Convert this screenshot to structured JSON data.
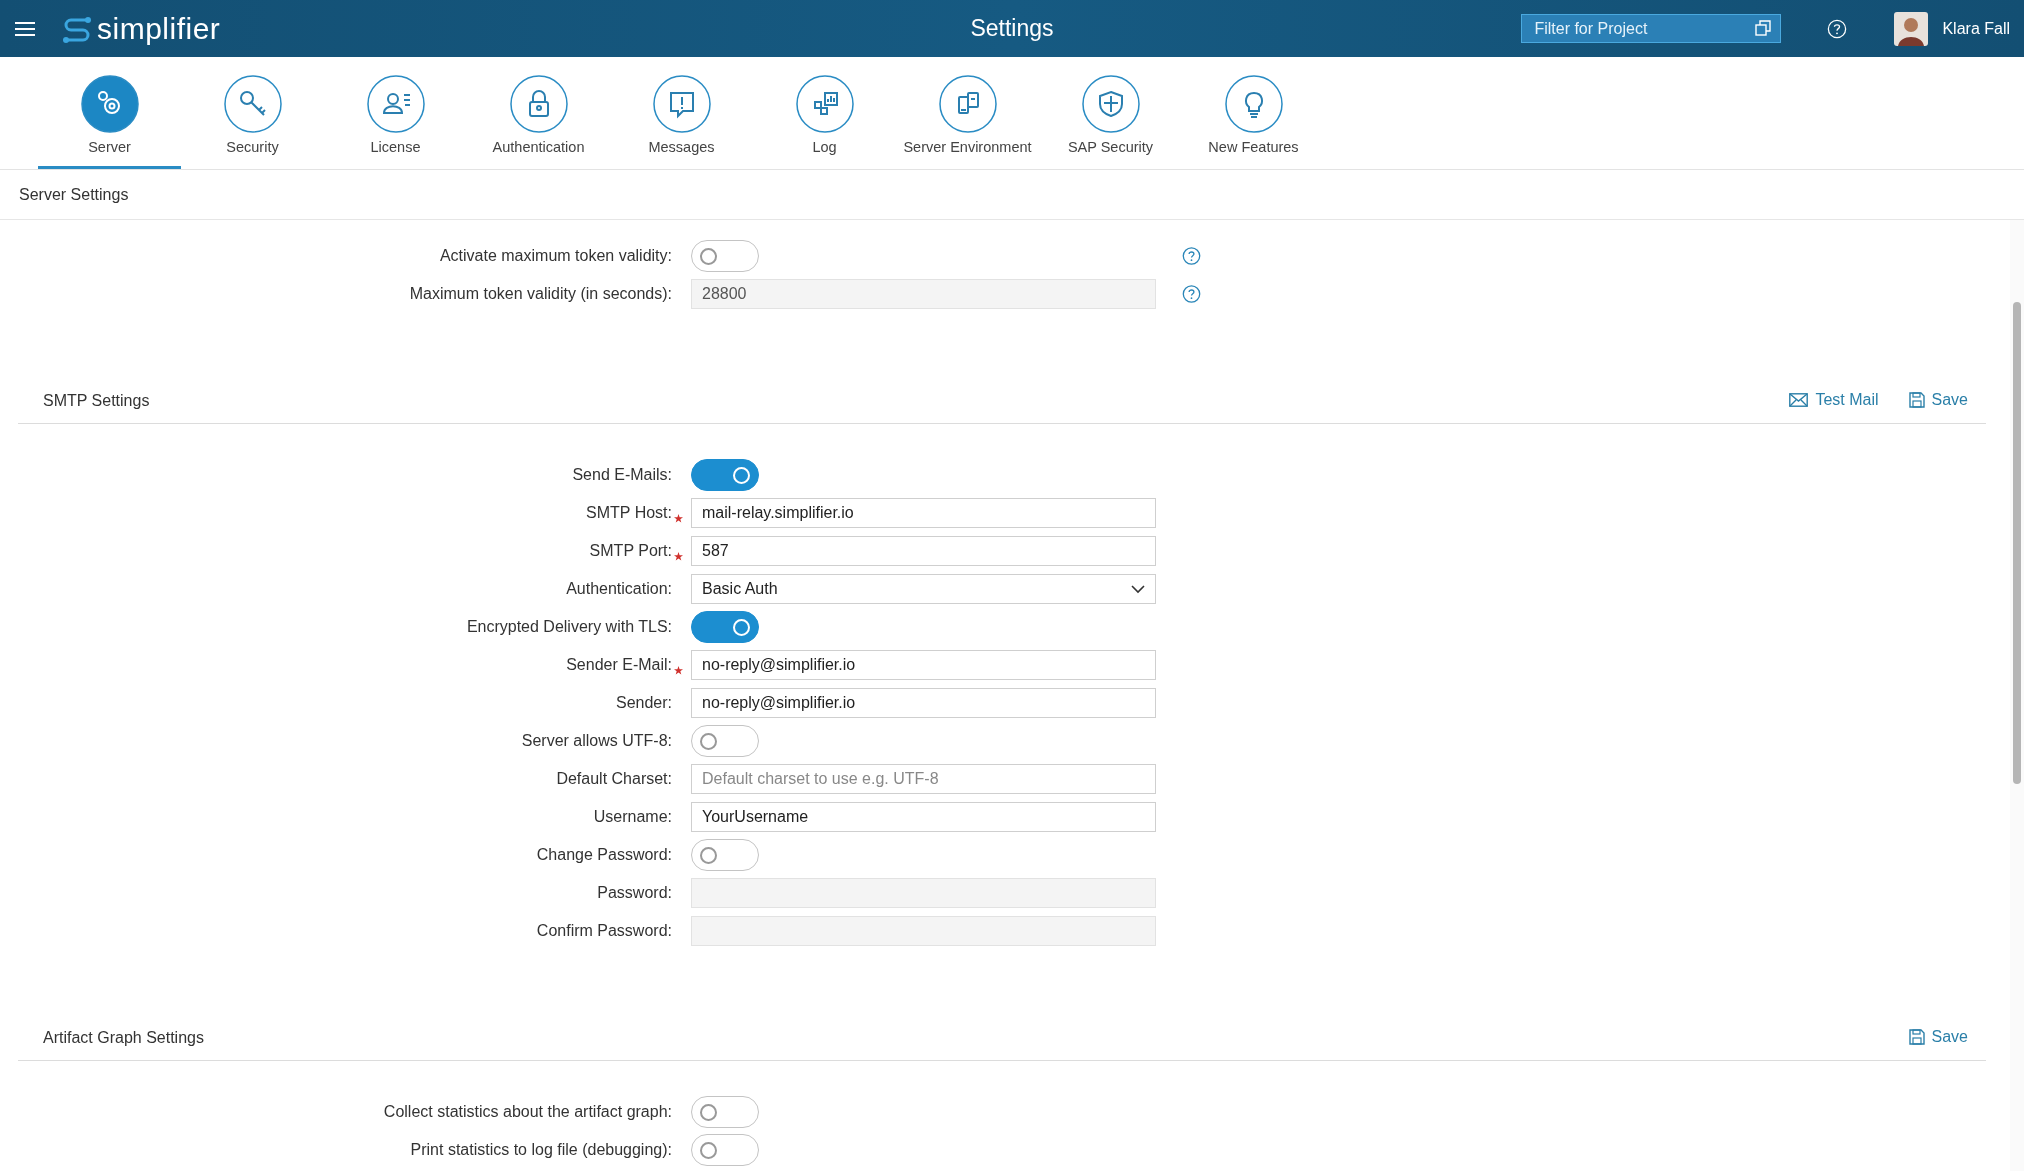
{
  "header": {
    "logo": "simplifier",
    "title": "Settings",
    "filter": {
      "placeholder": "Filter for Project"
    },
    "user": "Klara Fall"
  },
  "tabs": [
    {
      "label": "Server",
      "selected": true
    },
    {
      "label": "Security",
      "selected": false
    },
    {
      "label": "License",
      "selected": false
    },
    {
      "label": "Authentication",
      "selected": false
    },
    {
      "label": "Messages",
      "selected": false
    },
    {
      "label": "Log",
      "selected": false
    },
    {
      "label": "Server Environment",
      "selected": false
    },
    {
      "label": "SAP Security",
      "selected": false
    },
    {
      "label": "New Features",
      "selected": false
    }
  ],
  "page_title": "Server Settings",
  "server_rows": [
    {
      "label": "Activate maximum token validity:",
      "kind": "toggle",
      "on": false,
      "required": false,
      "help": true
    },
    {
      "label": "Maximum token validity (in seconds):",
      "kind": "input",
      "value": "28800",
      "disabled": true,
      "required": false,
      "help": true
    }
  ],
  "sections": [
    {
      "title": "SMTP Settings",
      "actions": [
        {
          "kind": "mail",
          "label": "Test Mail"
        },
        {
          "kind": "save",
          "label": "Save"
        }
      ],
      "rows": [
        {
          "label": "Send E-Mails:",
          "kind": "toggle",
          "on": true,
          "required": false,
          "help": false
        },
        {
          "label": "SMTP Host:",
          "kind": "input",
          "value": "mail-relay.simplifier.io",
          "disabled": false,
          "required": true,
          "help": false
        },
        {
          "label": "SMTP Port:",
          "kind": "input",
          "value": "587",
          "disabled": false,
          "required": true,
          "help": false
        },
        {
          "label": "Authentication:",
          "kind": "select",
          "value": "Basic Auth",
          "required": false,
          "help": false
        },
        {
          "label": "Encrypted Delivery with TLS:",
          "kind": "toggle",
          "on": true,
          "required": false,
          "help": false
        },
        {
          "label": "Sender E-Mail:",
          "kind": "input",
          "value": "no-reply@simplifier.io",
          "disabled": false,
          "required": true,
          "help": false
        },
        {
          "label": "Sender:",
          "kind": "input",
          "value": "no-reply@simplifier.io",
          "disabled": false,
          "required": false,
          "help": false
        },
        {
          "label": "Server allows UTF-8:",
          "kind": "toggle",
          "on": false,
          "required": false,
          "help": false
        },
        {
          "label": "Default Charset:",
          "kind": "input",
          "placeholder": "Default charset to use e.g. UTF-8",
          "disabled": false,
          "required": false,
          "help": false
        },
        {
          "label": "Username:",
          "kind": "input",
          "value": "YourUsername",
          "disabled": false,
          "required": false,
          "help": false
        },
        {
          "label": "Change Password:",
          "kind": "toggle",
          "on": false,
          "required": false,
          "help": false
        },
        {
          "label": "Password:",
          "kind": "input",
          "disabled": true,
          "required": false,
          "help": false
        },
        {
          "label": "Confirm Password:",
          "kind": "input",
          "disabled": true,
          "required": false,
          "help": false
        }
      ]
    },
    {
      "title": "Artifact Graph Settings",
      "actions": [
        {
          "kind": "save",
          "label": "Save"
        }
      ],
      "rows": [
        {
          "label": "Collect statistics about the artifact graph:",
          "kind": "toggle",
          "on": false,
          "required": false,
          "help": false
        },
        {
          "label": "Print statistics to log file (debugging):",
          "kind": "toggle",
          "on": false,
          "required": false,
          "help": false
        }
      ]
    }
  ]
}
